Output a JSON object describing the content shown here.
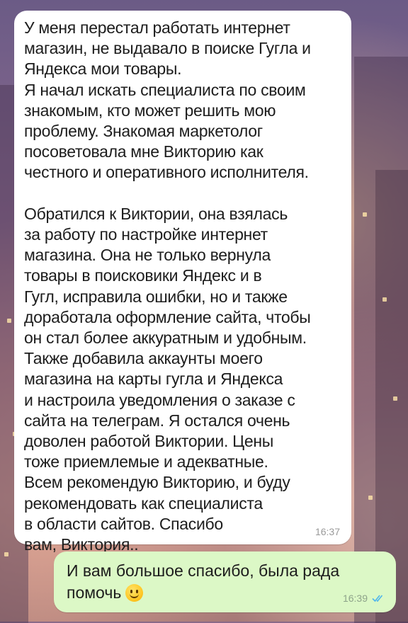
{
  "messages": [
    {
      "direction": "incoming",
      "text": "У меня перестал работать интернет\nмагазин, не выдавало в поиске Гугла и\nЯндекса мои товары.\nЯ начал искать специалиста по своим\nзнакомым, кто может решить мою\nпроблему. Знакомая маркетолог\nпосоветовала мне Викторию как\nчестного и оперативного исполнителя.\n\nОбратился к Виктории, она взялась\nза работу по настройке интернет\nмагазина. Она не только вернула\nтовары в поисковики Яндекс и в\nГугл, исправила ошибки, но и также\nдоработала оформление сайта, чтобы\nон стал более аккуратным и удобным.\nТакже добавила аккаунты моего\nмагазина на карты гугла и Яндекса\nи настроила уведомления о заказе с\nсайта на телеграм. Я остался очень\nдоволен работой Виктории. Цены\nтоже приемлемые и адекватные.\nВсем рекомендую Викторию, и буду\nрекомендовать как специалиста\nв области сайтов. Спасибо\nвам, Виктория..",
      "time": "16:37"
    },
    {
      "direction": "outgoing",
      "text": "И вам большое спасибо, была рада помочь",
      "emoji": "smiling-face-emoji",
      "time": "16:39",
      "status": "read",
      "status_color": "#4fb6ec"
    }
  ],
  "colors": {
    "incoming_bubble": "#ffffff",
    "outgoing_bubble": "#dcf8c6"
  }
}
